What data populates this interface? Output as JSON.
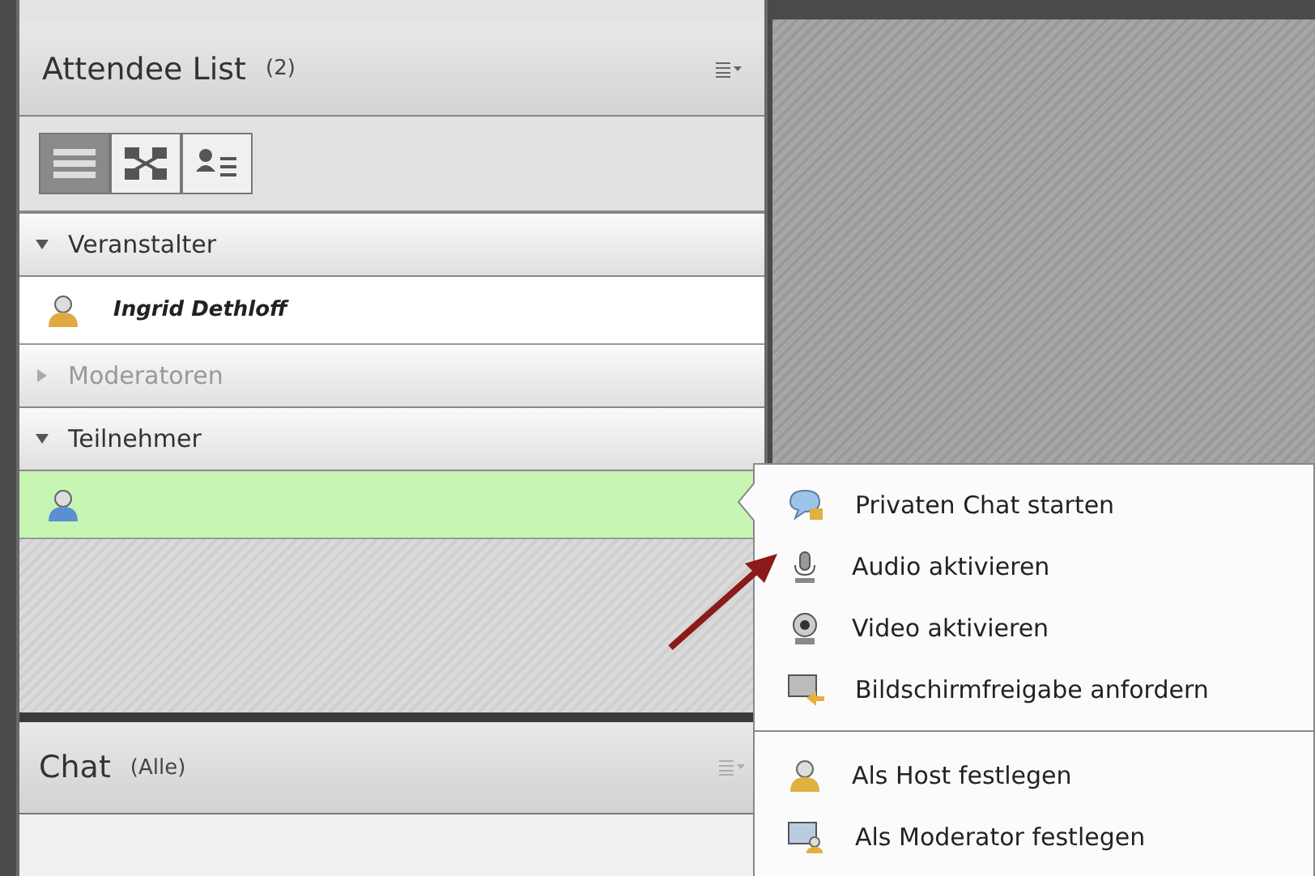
{
  "attendee_panel": {
    "title": "Attendee List",
    "count": "(2)",
    "view_buttons": [
      {
        "selected": true
      },
      {
        "selected": false
      },
      {
        "selected": false
      }
    ],
    "groups": [
      {
        "label": "Veranstalter",
        "expanded": true,
        "attendees": [
          {
            "name": "Ingrid Dethloff",
            "color": "#e0a840",
            "selected": false
          }
        ]
      },
      {
        "label": "Moderatoren",
        "expanded": false
      },
      {
        "label": "Teilnehmer",
        "expanded": true,
        "attendees": [
          {
            "color": "#5b8fd0",
            "selected": true
          }
        ]
      }
    ]
  },
  "context_menu": {
    "sections": [
      [
        "Privaten Chat starten",
        "Audio aktivieren",
        "Video aktivieren",
        "Bildschirmfreigabe anfordern"
      ],
      [
        "Als Host festlegen",
        "Als Moderator festlegen"
      ]
    ]
  },
  "chat_panel": {
    "title": "Chat",
    "filter": "(Alle)"
  }
}
